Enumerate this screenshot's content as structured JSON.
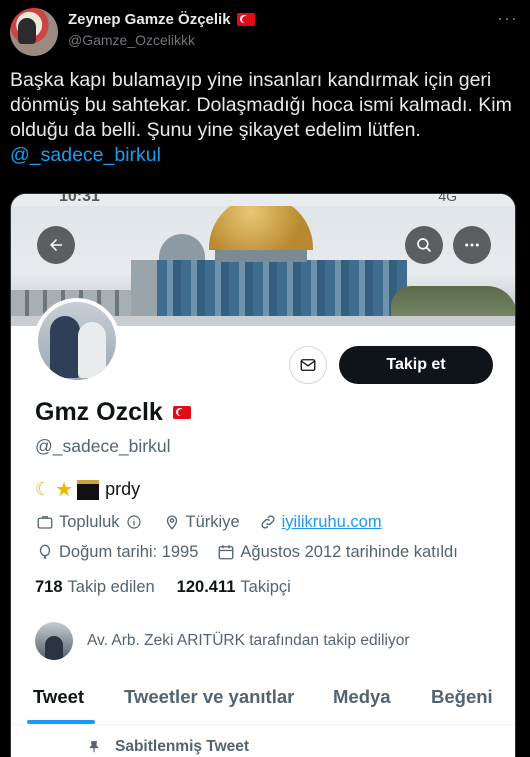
{
  "tweet": {
    "author_name": "Zeynep Gamze Özçelik",
    "author_handle": "@Gamze_Ozcelikkk",
    "more_label": "···",
    "text": "Başka kapı bulamayıp yine insanları kandırmak için geri dönmüş bu sahtekar. Dolaşmadığı hoca ismi kalmadı. Kim olduğu da belli. Şunu yine şikayet edelim lütfen. ",
    "mention": "@_sadece_birkul"
  },
  "screenshot": {
    "status_time": "10:31",
    "status_right": "4G",
    "profile": {
      "name": "Gmz Ozclk",
      "handle": "@_sadece_birkul",
      "bio_text": "prdy",
      "follow_label": "Takip et",
      "category": "Topluluk",
      "location": "Türkiye",
      "website": "iyilikruhu.com",
      "birth": "Doğum tarihi: 1995",
      "joined": "Ağustos 2012 tarihinde katıldı",
      "following_count": "718",
      "following_label": "Takip edilen",
      "followers_count": "120.411",
      "followers_label": "Takipçi",
      "followed_by": "Av. Arb. Zeki ARITÜRK tarafından takip ediliyor"
    },
    "tabs": [
      "Tweet",
      "Tweetler ve yanıtlar",
      "Medya",
      "Beğeni"
    ],
    "pinned_label": "Sabitlenmiş Tweet"
  },
  "colors": {
    "background": "#000000",
    "accent": "#1d9bf0",
    "card": "#ffffff",
    "follow_button": "#0f1419"
  },
  "icons": [
    "turkey-flag-icon",
    "more-dots-icon",
    "back-arrow-icon",
    "search-icon",
    "more-icon",
    "mail-icon",
    "moon-icon",
    "star-icon",
    "kaaba-icon",
    "briefcase-icon",
    "info-icon",
    "location-icon",
    "link-icon",
    "balloon-icon",
    "calendar-icon",
    "pin-icon"
  ]
}
